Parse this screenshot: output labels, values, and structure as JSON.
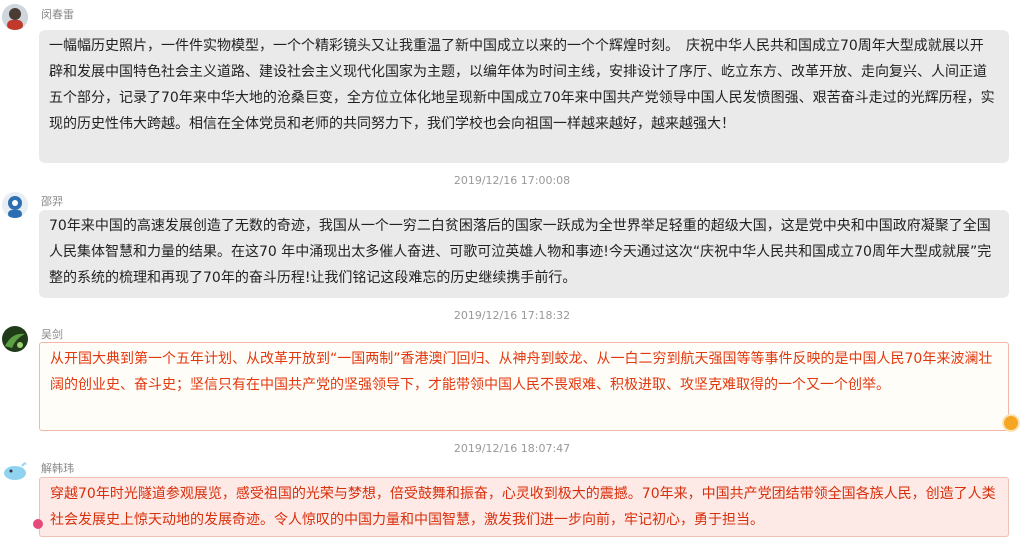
{
  "messages": [
    {
      "sender": "闵春雷",
      "text": "一幅幅历史照片，一件件实物模型，一个个精彩镜头又让我重温了新中国成立以来的一个个辉煌时刻。　庆祝中华人民共和国成立70周年大型成就展以开辟和发展中国特色社会主义道路、建设社会主义现代化国家为主题，以编年体为时间主线，安排设计了序厅、屹立东方、改革开放、走向复兴、人间正道五个部分，记录了70年来中华大地的沧桑巨变，全方位立体化地呈现新中国成立70年来中国共产党领导中国人民发愤图强、艰苦奋斗走过的光辉历程，实现的历史性伟大跨越。相信在全体党员和老师的共同努力下，我们学校也会向祖国一样越来越好，越来越强大！",
      "timestamp": "2019/12/16 17:00:08"
    },
    {
      "sender": "邵羿",
      "text": "70年来中国的高速发展创造了无数的奇迹，我国从一个一穷二白贫困落后的国家一跃成为全世界举足轻重的超级大国，这是党中央和中国政府凝聚了全国人民集体智慧和力量的结果。在这70 年中涌现出太多催人奋进、可歌可泣英雄人物和事迹!今天通过这次“庆祝中华人民共和国成立70周年大型成就展”完整的系统的梳理和再现了70年的奋斗历程!让我们铭记这段难忘的历史继续携手前行。",
      "timestamp": "2019/12/16 17:18:32"
    },
    {
      "sender": "吴剑",
      "text": "从开国大典到第一个五年计划、从改革开放到“一国两制”香港澳门回归、从神舟到蛟龙、从一白二穷到航天强国等等事件反映的是中国人民70年来波澜壮阔的创业史、奋斗史；坚信只有在中国共产党的坚强领导下，才能带领中国人民不畏艰难、积极进取、攻坚克难取得的一个又一个创举。",
      "timestamp": "2019/12/16 18:07:47"
    },
    {
      "sender": "解韩玮",
      "text": "穿越70年时光隧道参观展览，感受祖国的光荣与梦想，倍受鼓舞和振奋，心灵收到极大的震撼。70年来，中国共产党团结带领全国各族人民，创造了人类社会发展史上惊天动地的发展奇迹。令人惊叹的中国力量和中国智慧，激发我们进一步向前，牢记初心，勇于担当。"
    }
  ],
  "colors": {
    "gray_bubble": "#eaeaea",
    "red_text": "#e2380e",
    "pink_bubble": "#fde9e5",
    "timestamp": "#999999"
  }
}
